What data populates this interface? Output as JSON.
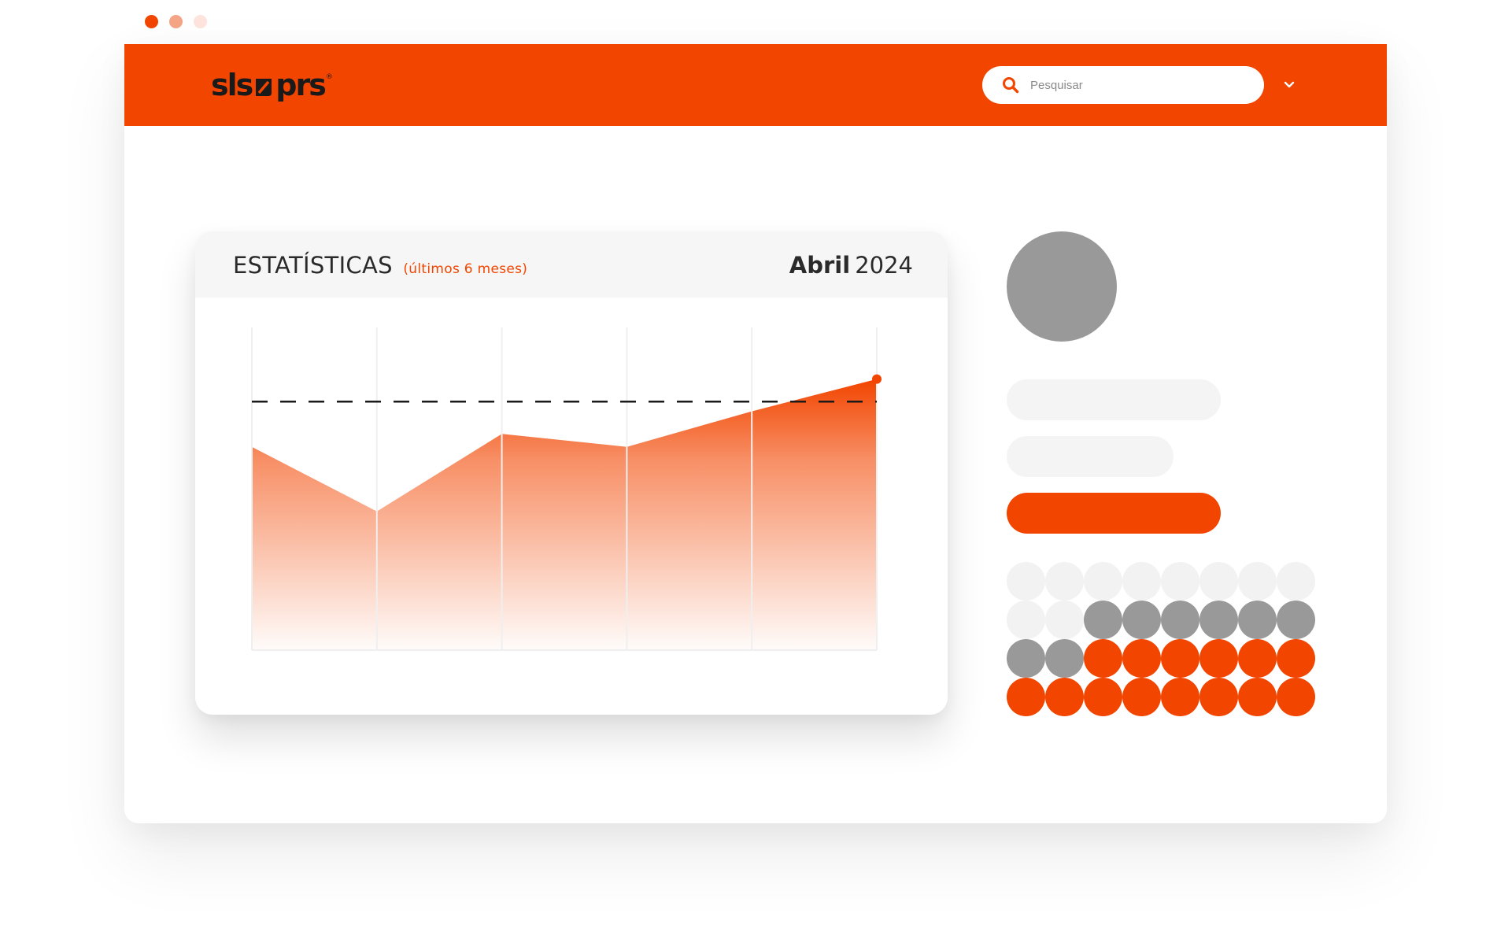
{
  "colors": {
    "accent": "#f24500",
    "accent_soft": "#f5a486",
    "accent_pale": "#fde4dc",
    "gray": "#999999",
    "light_gray": "#f2f2f2",
    "text_dark": "#2a2a2a"
  },
  "window_controls": [
    "close",
    "minimize",
    "maximize"
  ],
  "header": {
    "logo_text_left": "sls",
    "logo_text_right": "prs",
    "logo_reg": "®",
    "search_placeholder": "Pesquisar",
    "search_icon": "search-icon",
    "dropdown_icon": "chevron-down-icon"
  },
  "stats_card": {
    "title": "ESTATÍSTICAS",
    "subtitle": "(últimos 6 meses)",
    "month": "Abril",
    "year": "2024"
  },
  "chart_data": {
    "type": "area",
    "x": [
      1,
      2,
      3,
      4,
      5,
      6
    ],
    "series": [
      {
        "values": [
          63,
          43,
          67,
          63,
          74,
          84
        ]
      }
    ],
    "reference_line": {
      "value": 77,
      "style": "dashed"
    },
    "ylim": [
      0,
      100
    ],
    "grid": true,
    "title": "",
    "xlabel": "",
    "ylabel": ""
  },
  "profile_panel": {
    "dot_grid": [
      [
        "l",
        "l",
        "l",
        "l",
        "l",
        "l",
        "l",
        "l"
      ],
      [
        "l",
        "l",
        "g",
        "g",
        "g",
        "g",
        "g",
        "g"
      ],
      [
        "g",
        "g",
        "o",
        "o",
        "o",
        "o",
        "o",
        "o"
      ],
      [
        "o",
        "o",
        "o",
        "o",
        "o",
        "o",
        "o",
        "o"
      ]
    ]
  }
}
